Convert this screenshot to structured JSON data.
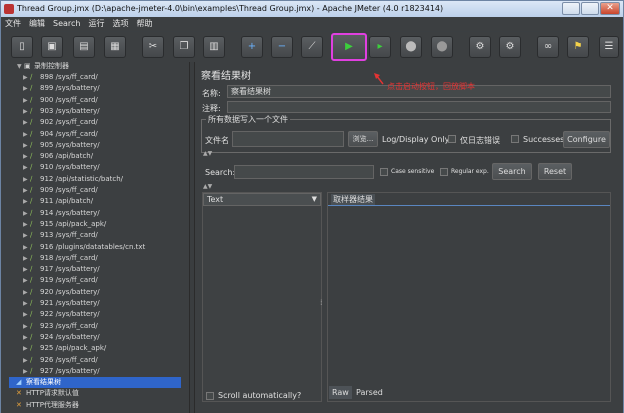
{
  "window": {
    "title": "Thread Group.jmx (D:\\apache-jmeter-4.0\\bin\\examples\\Thread Group.jmx) - Apache JMeter (4.0 r1823414)"
  },
  "menu": [
    "文件",
    "编辑",
    "Search",
    "运行",
    "选项",
    "帮助"
  ],
  "tree": {
    "root": "录制控制器",
    "items": [
      "898 /sys/ff_card/",
      "899 /sys/battery/",
      "900 /sys/ff_card/",
      "903 /sys/battery/",
      "902 /sys/ff_card/",
      "904 /sys/ff_card/",
      "905 /sys/battery/",
      "906 /api/batch/",
      "910 /sys/battery/",
      "912 /api/statistic/batch/",
      "909 /sys/ff_card/",
      "911 /api/batch/",
      "914 /sys/battery/",
      "915 /api/pack_apk/",
      "913 /sys/ff_card/",
      "916 /plugins/datatables/cn.txt",
      "918 /sys/ff_card/",
      "917 /sys/battery/",
      "919 /sys/ff_card/",
      "920 /sys/battery/",
      "921 /sys/battery/",
      "922 /sys/battery/",
      "923 /sys/ff_card/",
      "924 /sys/battery/",
      "925 /api/pack_apk/",
      "926 /sys/ff_card/",
      "927 /sys/battery/"
    ],
    "selected": "察看结果树",
    "after": [
      "HTTP请求默认值",
      "HTTP代理服务器"
    ]
  },
  "panel": {
    "title": "察看结果树",
    "name_label": "名称:",
    "name_value": "察看结果树",
    "comment_label": "注释:",
    "group_title": "所有数据写入一个文件",
    "filename_label": "文件名",
    "browse_button": "浏览...",
    "log_display_label": "Log/Display Only:",
    "errors_only": "仅日志错误",
    "successes": "Successes",
    "configure_button": "Configure",
    "search_label": "Search:",
    "case_sensitive": "Case sensitive",
    "regular_exp": "Regular exp.",
    "search_button": "Search",
    "reset_button": "Reset",
    "renderer_value": "Text",
    "sampler_result_tab": "取样器结果",
    "scroll_auto": "Scroll automatically?",
    "raw_tab": "Raw",
    "parsed_tab": "Parsed"
  },
  "annotation": "点击启动按钮，回放脚本",
  "colors": {
    "highlight": "#e040e0",
    "annotation": "#e53333",
    "selected_row": "#2f65ca"
  }
}
